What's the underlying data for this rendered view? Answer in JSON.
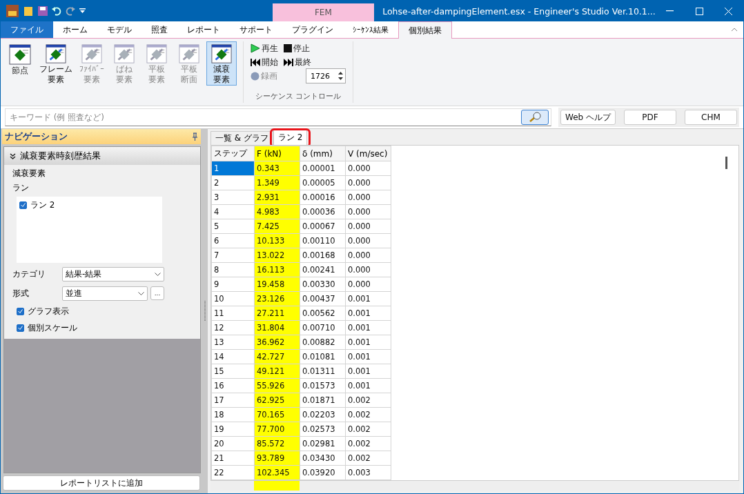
{
  "window": {
    "title": "Lohse-after-dampingElement.esx - Engineer's Studio Ver.10.1...",
    "context_tab_group": "FEM"
  },
  "ribbon_tabs": [
    {
      "label": "ファイル",
      "kind": "file",
      "selected": false
    },
    {
      "label": "ホーム",
      "kind": "normal",
      "selected": false
    },
    {
      "label": "モデル",
      "kind": "normal",
      "selected": false
    },
    {
      "label": "照査",
      "kind": "normal",
      "selected": false
    },
    {
      "label": "レポート",
      "kind": "normal",
      "selected": false
    },
    {
      "label": "サポート",
      "kind": "normal",
      "selected": false
    },
    {
      "label": "プラグイン",
      "kind": "normal",
      "selected": false
    },
    {
      "label": "ｼｰｹﾝｽ結果",
      "kind": "context",
      "selected": false
    },
    {
      "label": "個別結果",
      "kind": "context",
      "selected": true
    }
  ],
  "ribbon_buttons": [
    {
      "lines": [
        "節点"
      ],
      "disabled": false,
      "selected": false
    },
    {
      "lines": [
        "フレーム",
        "要素"
      ],
      "disabled": false,
      "selected": false
    },
    {
      "lines": [
        "ﾌｧｲﾊﾞｰ",
        "要素"
      ],
      "disabled": true,
      "selected": false
    },
    {
      "lines": [
        "ばね",
        "要素"
      ],
      "disabled": true,
      "selected": false
    },
    {
      "lines": [
        "平板",
        "要素"
      ],
      "disabled": true,
      "selected": false
    },
    {
      "lines": [
        "平板",
        "断面"
      ],
      "disabled": true,
      "selected": false
    },
    {
      "lines": [
        "減衰",
        "要素"
      ],
      "disabled": false,
      "selected": true
    }
  ],
  "sequence_control": {
    "group_label": "シーケンス コントロール",
    "play": "再生",
    "stop": "停止",
    "start": "開始",
    "end": "最終",
    "record": {
      "label": "録画",
      "disabled": true
    },
    "frame": "1726"
  },
  "search": {
    "placeholder": "キーワード (例 照査など)"
  },
  "help_buttons": [
    "Web ヘルプ",
    "PDF",
    "CHM"
  ],
  "navigation": {
    "title": "ナビゲーション",
    "section": {
      "title": "減衰要素時刻歴結果",
      "expanded": true
    },
    "element_label": "減衰要素",
    "run_label": "ラン",
    "runs": [
      {
        "label": "ラン 2",
        "checked": true
      }
    ],
    "category": {
      "label": "カテゴリ",
      "value": "結果-結果"
    },
    "format": {
      "label": "形式",
      "value": "並進",
      "more": "..."
    },
    "options": [
      {
        "label": "グラフ表示",
        "checked": true
      },
      {
        "label": "個別スケール",
        "checked": true
      }
    ],
    "add_button": "レポートリストに追加"
  },
  "doc_tabs": [
    {
      "label": "一覧 & グラフ",
      "selected": false,
      "highlighted": false
    },
    {
      "label": "ラン 2",
      "selected": true,
      "highlighted": true
    }
  ],
  "table": {
    "columns": [
      {
        "label": "ステップ",
        "highlighted": false
      },
      {
        "label": "F (kN)",
        "highlighted": true
      },
      {
        "label": "δ (mm)",
        "highlighted": false
      },
      {
        "label": "V (m/sec)",
        "highlighted": false
      }
    ],
    "rows": [
      {
        "cells": [
          "1",
          "0.343",
          "0.00001",
          "0.000"
        ],
        "selected": true
      },
      {
        "cells": [
          "2",
          "1.349",
          "0.00005",
          "0.000"
        ],
        "selected": false
      },
      {
        "cells": [
          "3",
          "2.931",
          "0.00016",
          "0.000"
        ],
        "selected": false
      },
      {
        "cells": [
          "4",
          "4.983",
          "0.00036",
          "0.000"
        ],
        "selected": false
      },
      {
        "cells": [
          "5",
          "7.425",
          "0.00067",
          "0.000"
        ],
        "selected": false
      },
      {
        "cells": [
          "6",
          "10.133",
          "0.00110",
          "0.000"
        ],
        "selected": false
      },
      {
        "cells": [
          "7",
          "13.022",
          "0.00168",
          "0.000"
        ],
        "selected": false
      },
      {
        "cells": [
          "8",
          "16.113",
          "0.00241",
          "0.000"
        ],
        "selected": false
      },
      {
        "cells": [
          "9",
          "19.458",
          "0.00330",
          "0.000"
        ],
        "selected": false
      },
      {
        "cells": [
          "10",
          "23.126",
          "0.00437",
          "0.001"
        ],
        "selected": false
      },
      {
        "cells": [
          "11",
          "27.211",
          "0.00562",
          "0.001"
        ],
        "selected": false
      },
      {
        "cells": [
          "12",
          "31.804",
          "0.00710",
          "0.001"
        ],
        "selected": false
      },
      {
        "cells": [
          "13",
          "36.962",
          "0.00882",
          "0.001"
        ],
        "selected": false
      },
      {
        "cells": [
          "14",
          "42.727",
          "0.01081",
          "0.001"
        ],
        "selected": false
      },
      {
        "cells": [
          "15",
          "49.121",
          "0.01311",
          "0.001"
        ],
        "selected": false
      },
      {
        "cells": [
          "16",
          "55.926",
          "0.01573",
          "0.001"
        ],
        "selected": false
      },
      {
        "cells": [
          "17",
          "62.925",
          "0.01871",
          "0.002"
        ],
        "selected": false
      },
      {
        "cells": [
          "18",
          "70.165",
          "0.02203",
          "0.002"
        ],
        "selected": false
      },
      {
        "cells": [
          "19",
          "77.700",
          "0.02573",
          "0.002"
        ],
        "selected": false
      },
      {
        "cells": [
          "20",
          "85.572",
          "0.02981",
          "0.002"
        ],
        "selected": false
      },
      {
        "cells": [
          "21",
          "93.789",
          "0.03430",
          "0.002"
        ],
        "selected": false
      },
      {
        "cells": [
          "22",
          "102.345",
          "0.03920",
          "0.003"
        ],
        "selected": false
      }
    ]
  }
}
